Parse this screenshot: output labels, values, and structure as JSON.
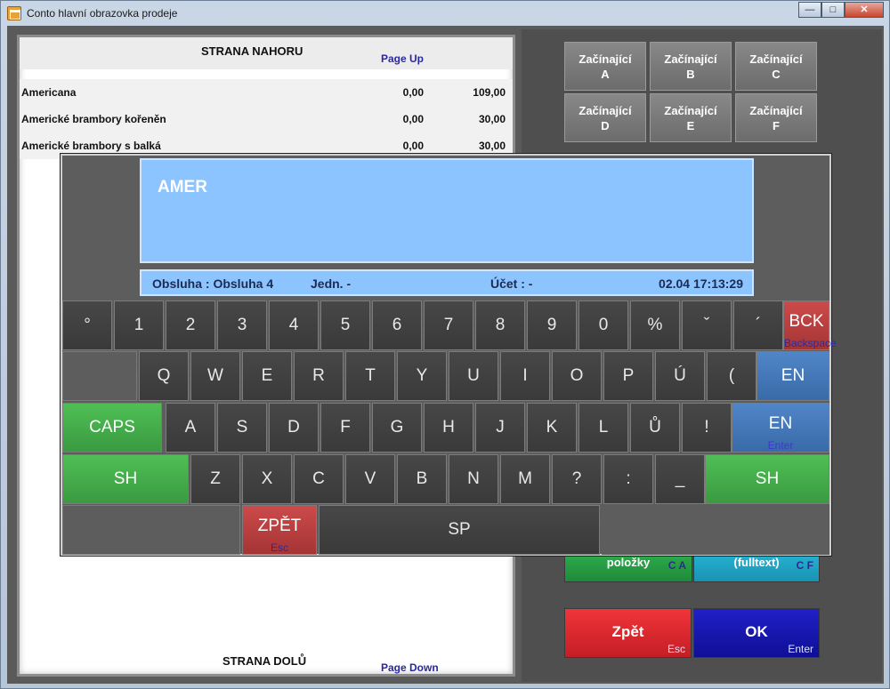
{
  "window": {
    "title": "Conto hlavní obrazovka prodeje",
    "controls": [
      "—",
      "□",
      "✕"
    ]
  },
  "list": {
    "page_up_title": "STRANA NAHORU",
    "page_up_key": "Page Up",
    "rows": [
      {
        "name": "Americana",
        "c1": "0,00",
        "c2": "109,00"
      },
      {
        "name": "Americké brambory kořeněn",
        "c1": "0,00",
        "c2": "30,00"
      },
      {
        "name": "Americké brambory s balká",
        "c1": "0,00",
        "c2": "30,00"
      }
    ],
    "page_down_title": "STRANA DOLŮ",
    "page_down_key": "Page Down"
  },
  "categories": [
    {
      "line1": "Začínající",
      "line2": "A"
    },
    {
      "line1": "Začínající",
      "line2": "B"
    },
    {
      "line1": "Začínající",
      "line2": "C"
    },
    {
      "line1": "Začínající",
      "line2": "D"
    },
    {
      "line1": "Začínající",
      "line2": "E"
    },
    {
      "line1": "Začínající",
      "line2": "F"
    }
  ],
  "search_buttons": {
    "items_label": "položky",
    "items_hint": "C A",
    "fulltext_label": "(fulltext)",
    "fulltext_hint": "C F"
  },
  "actions": {
    "back_label": "Zpět",
    "back_hint": "Esc",
    "ok_label": "OK",
    "ok_hint": "Enter"
  },
  "keyboard": {
    "input_value": "AMER",
    "status": {
      "waiter": "Obsluha : Obsluha 4",
      "unit": "Jedn. -",
      "account": "Účet : -",
      "datetime": "02.04 17:13:29"
    },
    "row1": [
      "°",
      "1",
      "2",
      "3",
      "4",
      "5",
      "6",
      "7",
      "8",
      "9",
      "0",
      "%",
      "ˇ",
      "´"
    ],
    "row2": [
      "Q",
      "W",
      "E",
      "R",
      "T",
      "Y",
      "U",
      "I",
      "O",
      "P",
      "Ú",
      "("
    ],
    "row3": [
      "A",
      "S",
      "D",
      "F",
      "G",
      "H",
      "J",
      "K",
      "L",
      "Ů",
      "!"
    ],
    "row4": [
      "Z",
      "X",
      "C",
      "V",
      "B",
      "N",
      "M",
      "?",
      ":",
      "_"
    ],
    "bck_label": "BCK",
    "bck_sub": "Backspace",
    "lang_label": "EN",
    "enter_label": "EN",
    "enter_sub": "Enter",
    "caps_label": "CAPS",
    "shift_label": "SH",
    "esc_label": "ZPĚT",
    "esc_sub": "Esc",
    "space_label": "SP"
  }
}
